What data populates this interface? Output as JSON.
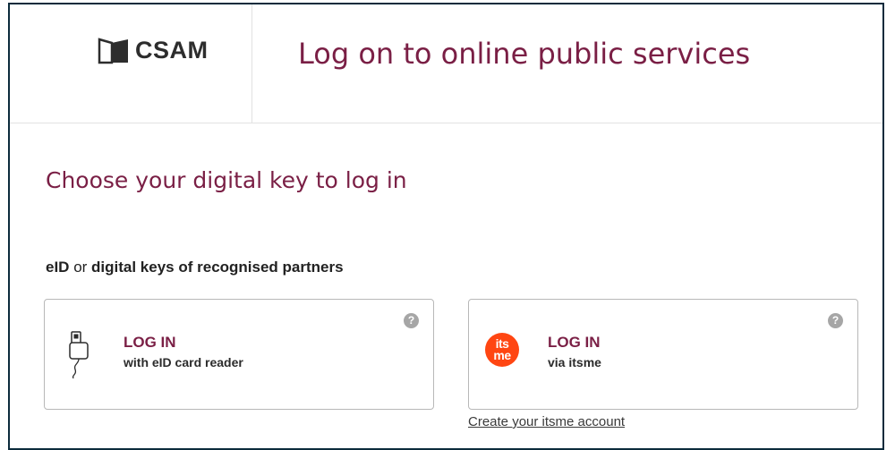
{
  "header": {
    "logo_text": "CSAM",
    "title": "Log on to online public services"
  },
  "main": {
    "heading": "Choose your digital key to log in",
    "section_label": {
      "part1": "eID",
      "part2": " or ",
      "part3": "digital keys of recognised partners"
    },
    "cards": [
      {
        "title": "LOG IN",
        "subtitle": "with eID card reader",
        "icon": "card-reader-icon",
        "help": "?"
      },
      {
        "title": "LOG IN",
        "subtitle": "via itsme",
        "icon": "itsme-logo",
        "badge_line1": "its",
        "badge_line2": "me",
        "help": "?"
      }
    ],
    "create_account_link": "Create your itsme account"
  },
  "colors": {
    "brand": "#7a1f45",
    "frame_border": "#0c2b3c",
    "itsme_orange": "#ff4612",
    "help_grey": "#a6a6a6"
  }
}
